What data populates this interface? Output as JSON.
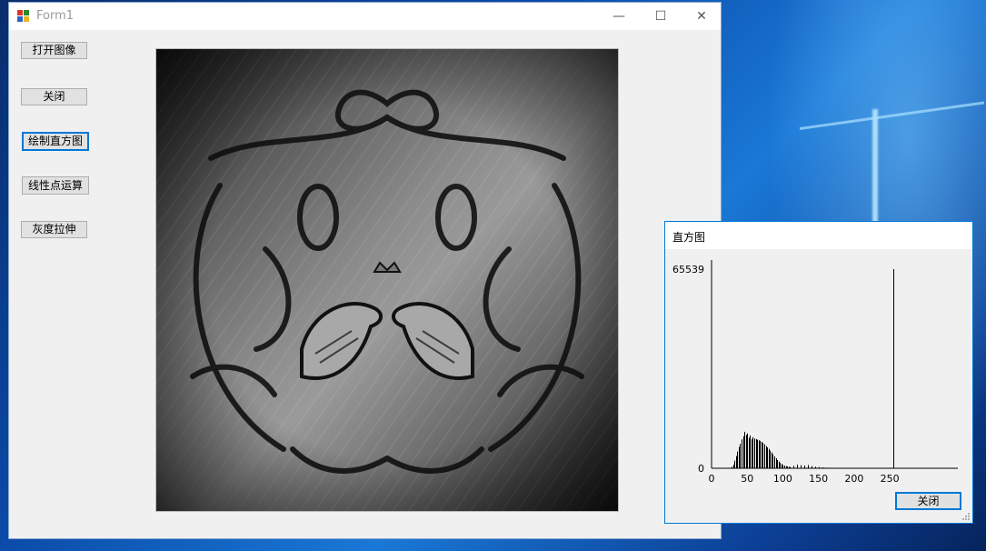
{
  "main_window": {
    "title": "Form1",
    "controls": {
      "minimize": "—",
      "maximize": "☐",
      "close": "✕"
    },
    "buttons": {
      "open_image": "打开图像",
      "close": "关闭",
      "draw_histogram": "绘制直方图",
      "linear_point_op": "线性点运算",
      "gray_stretch": "灰度拉伸"
    },
    "image_icon": "bird-ornament-image"
  },
  "histogram_window": {
    "title": "直方图",
    "close_button": "关闭",
    "chart_data": {
      "type": "bar",
      "x_ticks": [
        "0",
        "50",
        "100",
        "150",
        "200",
        "250"
      ],
      "y_ticks": [
        "0",
        "65539"
      ],
      "xlim": [
        0,
        255
      ],
      "ylim": [
        0,
        65539
      ],
      "x": [
        28,
        30,
        32,
        34,
        36,
        38,
        40,
        42,
        44,
        46,
        48,
        50,
        52,
        54,
        56,
        58,
        60,
        62,
        64,
        66,
        68,
        70,
        72,
        74,
        76,
        78,
        80,
        82,
        84,
        86,
        88,
        90,
        92,
        94,
        96,
        98,
        100,
        102,
        104,
        106,
        108,
        110,
        115,
        120,
        125,
        130,
        135,
        140,
        145,
        150,
        155,
        160,
        255
      ],
      "values": [
        500,
        1200,
        2500,
        4000,
        5500,
        7000,
        8000,
        9500,
        10500,
        12000,
        11000,
        11500,
        10000,
        10800,
        9500,
        10200,
        9800,
        9600,
        9400,
        9200,
        9000,
        8700,
        8300,
        7900,
        7300,
        6900,
        6400,
        5800,
        5200,
        4600,
        3900,
        3300,
        2700,
        2200,
        1800,
        1400,
        1100,
        900,
        700,
        600,
        500,
        400,
        800,
        1200,
        1000,
        900,
        1100,
        700,
        500,
        400,
        300,
        200,
        65539
      ]
    }
  }
}
